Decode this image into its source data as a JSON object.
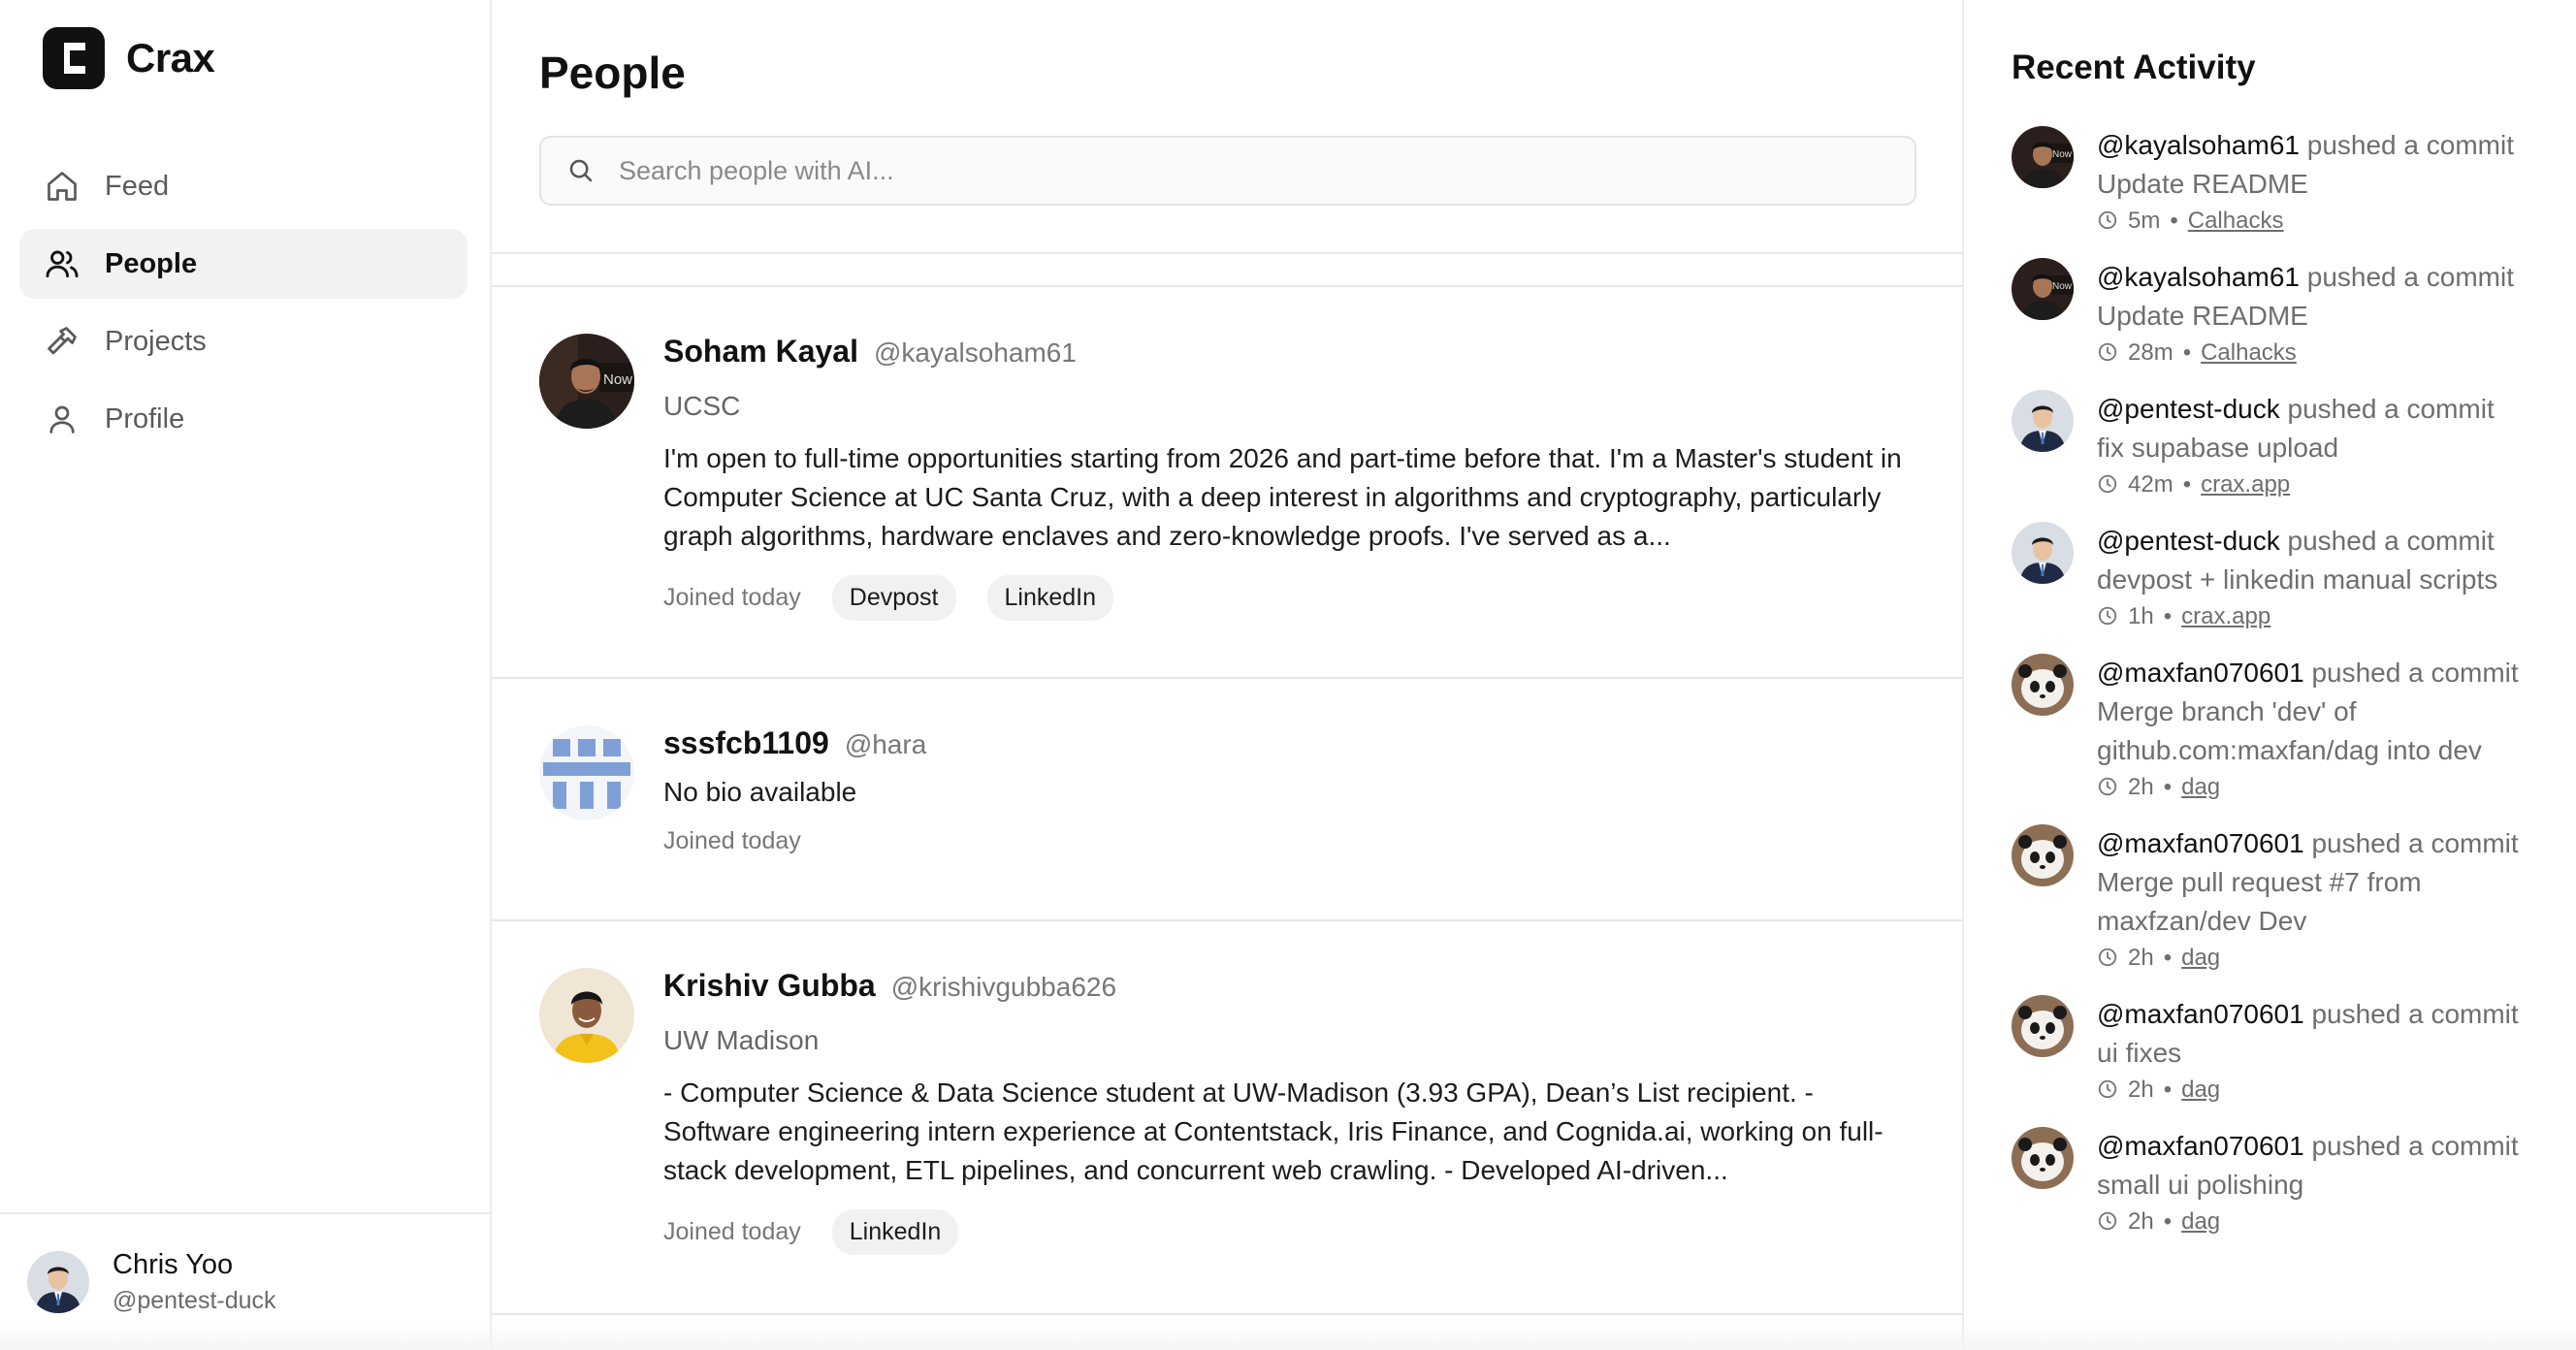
{
  "app": {
    "name": "Crax"
  },
  "sidebar": {
    "items": [
      {
        "label": "Feed",
        "icon": "home-icon",
        "active": false
      },
      {
        "label": "People",
        "icon": "users-icon",
        "active": true
      },
      {
        "label": "Projects",
        "icon": "hammer-icon",
        "active": false
      },
      {
        "label": "Profile",
        "icon": "user-icon",
        "active": false
      }
    ],
    "user": {
      "name": "Chris Yoo",
      "handle": "@pentest-duck"
    }
  },
  "main": {
    "title": "People",
    "search_placeholder": "Search people with AI...",
    "people": [
      {
        "name": "Soham Kayal",
        "handle": "@kayalsoham61",
        "school": "UCSC",
        "bio": "I'm open to full-time opportunities starting from 2026 and part-time before that. I'm a Master's student in Computer Science at UC Santa Cruz, with a deep interest in algorithms and cryptography, particularly graph algorithms, hardware enclaves and zero-knowledge proofs. I've served as a...",
        "joined": "Joined today",
        "links": [
          "Devpost",
          "LinkedIn"
        ]
      },
      {
        "name": "sssfcb1109",
        "handle": "@hara",
        "school": "",
        "bio": "No bio available",
        "joined": "Joined today",
        "links": []
      },
      {
        "name": "Krishiv Gubba",
        "handle": "@krishivgubba626",
        "school": "UW Madison",
        "bio": "- Computer Science & Data Science student at UW-Madison (3.93 GPA), Dean’s List recipient. - Software engineering intern experience at Contentstack, Iris Finance, and Cognida.ai, working on full- stack development, ETL pipelines, and concurrent web crawling. - Developed AI-driven...",
        "joined": "Joined today",
        "links": [
          "LinkedIn"
        ]
      }
    ]
  },
  "activity": {
    "title": "Recent Activity",
    "action_text": "pushed a commit",
    "items": [
      {
        "user": "@kayalsoham61",
        "message": "Update README",
        "time": "5m",
        "repo": "Calhacks"
      },
      {
        "user": "@kayalsoham61",
        "message": "Update README",
        "time": "28m",
        "repo": "Calhacks"
      },
      {
        "user": "@pentest-duck",
        "message": "fix supabase upload",
        "time": "42m",
        "repo": "crax.app"
      },
      {
        "user": "@pentest-duck",
        "message": "devpost + linkedin manual scripts",
        "time": "1h",
        "repo": "crax.app"
      },
      {
        "user": "@maxfan070601",
        "message": "Merge branch 'dev' of github.com:maxfan/dag into dev",
        "time": "2h",
        "repo": "dag"
      },
      {
        "user": "@maxfan070601",
        "message": "Merge pull request #7 from maxfzan/dev Dev",
        "time": "2h",
        "repo": "dag"
      },
      {
        "user": "@maxfan070601",
        "message": "ui fixes",
        "time": "2h",
        "repo": "dag"
      },
      {
        "user": "@maxfan070601",
        "message": "small ui polishing",
        "time": "2h",
        "repo": "dag"
      }
    ]
  }
}
